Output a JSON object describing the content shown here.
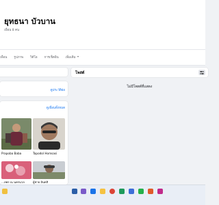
{
  "profile": {
    "name": "ยุทธนา บัวบาน",
    "friends_count": "เพื่อน 8 คน"
  },
  "tabs": [
    {
      "label": "เพื่อน"
    },
    {
      "label": "รูปภาพ"
    },
    {
      "label": "วิดีโอ"
    },
    {
      "label": "การเช็คอิน"
    },
    {
      "label": "เพิ่มเติม"
    }
  ],
  "about": {
    "link": "ดูประวัติย่อ"
  },
  "friends": {
    "link": "ดูเพื่อนทั้งหมด",
    "items": [
      {
        "name": "Prapoba Baba"
      },
      {
        "name": "Tapodol Homsasi"
      },
      {
        "name": "...ลพร ณ นครนวล"
      },
      {
        "name": "ผู้ชาย อินทสิ"
      }
    ]
  },
  "posts": {
    "title": "โพสต์",
    "empty_text": "ไม่มีโพสต์ที่แสดง"
  },
  "colors": {
    "accent": "#1877f2",
    "background": "#f0f2f5"
  }
}
